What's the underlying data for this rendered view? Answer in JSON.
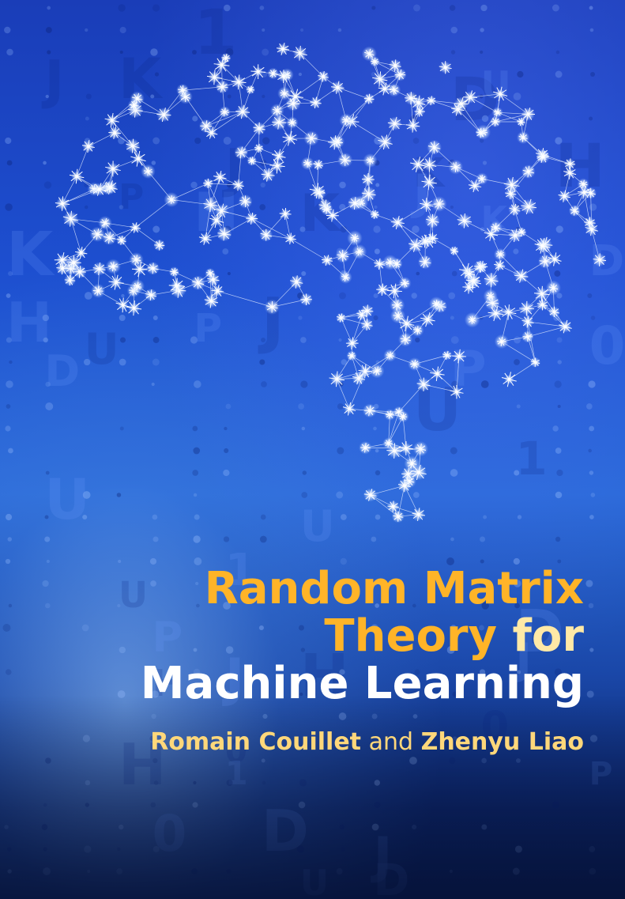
{
  "title": {
    "line1": "Random Matrix",
    "line2_gold": "Theory",
    "line2_pale": "for",
    "line3": "Machine Learning"
  },
  "authors": {
    "first": "Romain Couillet",
    "joiner": "and",
    "second": "Zhenyu Liao"
  },
  "colors": {
    "title_gold": "#ffb428",
    "title_pale": "#ffe9a6",
    "title_white": "#ffffff",
    "author": "#ffd77a",
    "background_top": "#1a3db8",
    "background_bottom": "#081a4a"
  },
  "imagery": {
    "background_icon": "binary-code-pattern",
    "foreground_icon": "brain-network-graph"
  }
}
